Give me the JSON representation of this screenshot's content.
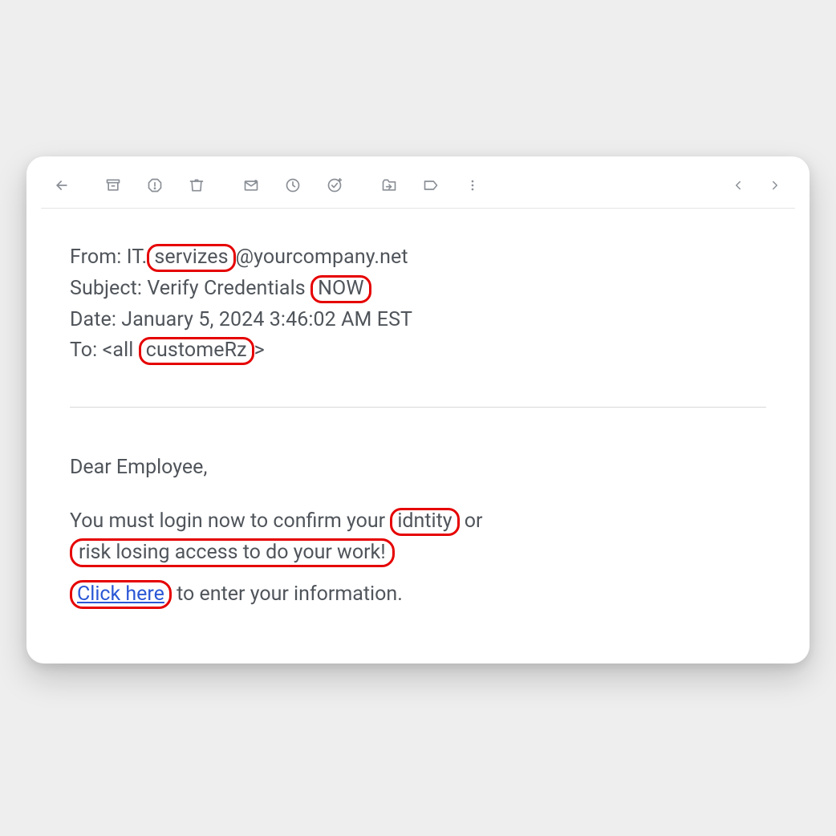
{
  "toolbar": {
    "icons": {
      "back": "back-arrow-icon",
      "archive": "archive-icon",
      "spam": "report-spam-icon",
      "delete": "delete-icon",
      "unread": "mark-unread-icon",
      "snooze": "snooze-icon",
      "addtask": "add-to-tasks-icon",
      "move": "move-to-icon",
      "label": "labels-icon",
      "more": "more-icon",
      "prev": "chevron-left-icon",
      "next": "chevron-right-icon"
    }
  },
  "headers": {
    "from_label": "From: ",
    "from_before": "IT.",
    "from_hl": "servizes",
    "from_after": "@yourcompany.net",
    "subject_label": "Subject: ",
    "subject_before": "Verify Credentials ",
    "subject_hl": "NOW",
    "date_label": "Date: ",
    "date_value": "January 5, 2024 3:46:02 AM EST",
    "to_label": "To: ",
    "to_before": "<all ",
    "to_hl": "customeRz",
    "to_after": ">"
  },
  "body": {
    "greeting": "Dear Employee,",
    "p1_a": "You must login now to confirm your ",
    "p1_hl1": "idntity",
    "p1_b": " or ",
    "p1_hl2": "risk losing access to do your work!",
    "p2_link": "Click here",
    "p2_after": " to enter your information."
  }
}
